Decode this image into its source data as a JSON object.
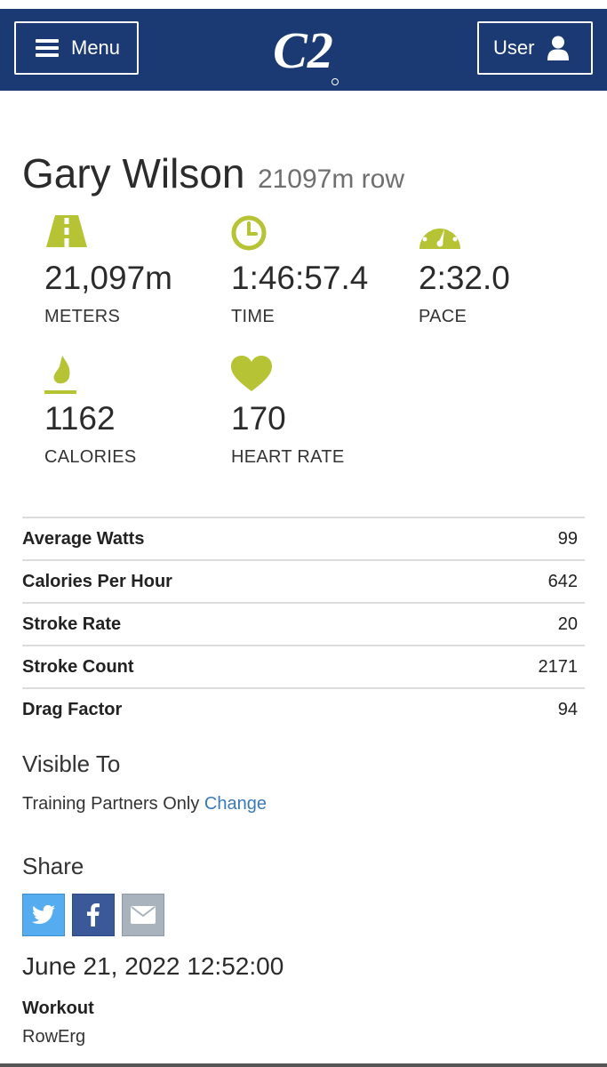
{
  "header": {
    "menu_label": "Menu",
    "user_label": "User",
    "logo_text": "C2",
    "bg_color": "#1b3a73"
  },
  "workout": {
    "athlete_name": "Gary Wilson",
    "description": "21097m row"
  },
  "stats": [
    {
      "icon": "road-icon",
      "value": "21,097m",
      "label": "METERS"
    },
    {
      "icon": "clock-icon",
      "value": "1:46:57.4",
      "label": "TIME"
    },
    {
      "icon": "speedometer-icon",
      "value": "2:32.0",
      "label": "PACE"
    },
    {
      "icon": "flame-icon",
      "value": "1162",
      "label": "CALORIES"
    },
    {
      "icon": "heart-icon",
      "value": "170",
      "label": "HEART RATE"
    }
  ],
  "accent_color": "#b5c334",
  "details": [
    {
      "label": "Average Watts",
      "value": "99"
    },
    {
      "label": "Calories Per Hour",
      "value": "642"
    },
    {
      "label": "Stroke Rate",
      "value": "20"
    },
    {
      "label": "Stroke Count",
      "value": "2171"
    },
    {
      "label": "Drag Factor",
      "value": "94"
    }
  ],
  "visibility": {
    "heading": "Visible To",
    "value": "Training Partners Only",
    "change_link": "Change"
  },
  "share": {
    "heading": "Share",
    "buttons": [
      "twitter-icon",
      "facebook-icon",
      "email-icon"
    ]
  },
  "date": "June 21, 2022 12:52:00",
  "workout_type": {
    "label": "Workout",
    "value": "RowErg"
  }
}
